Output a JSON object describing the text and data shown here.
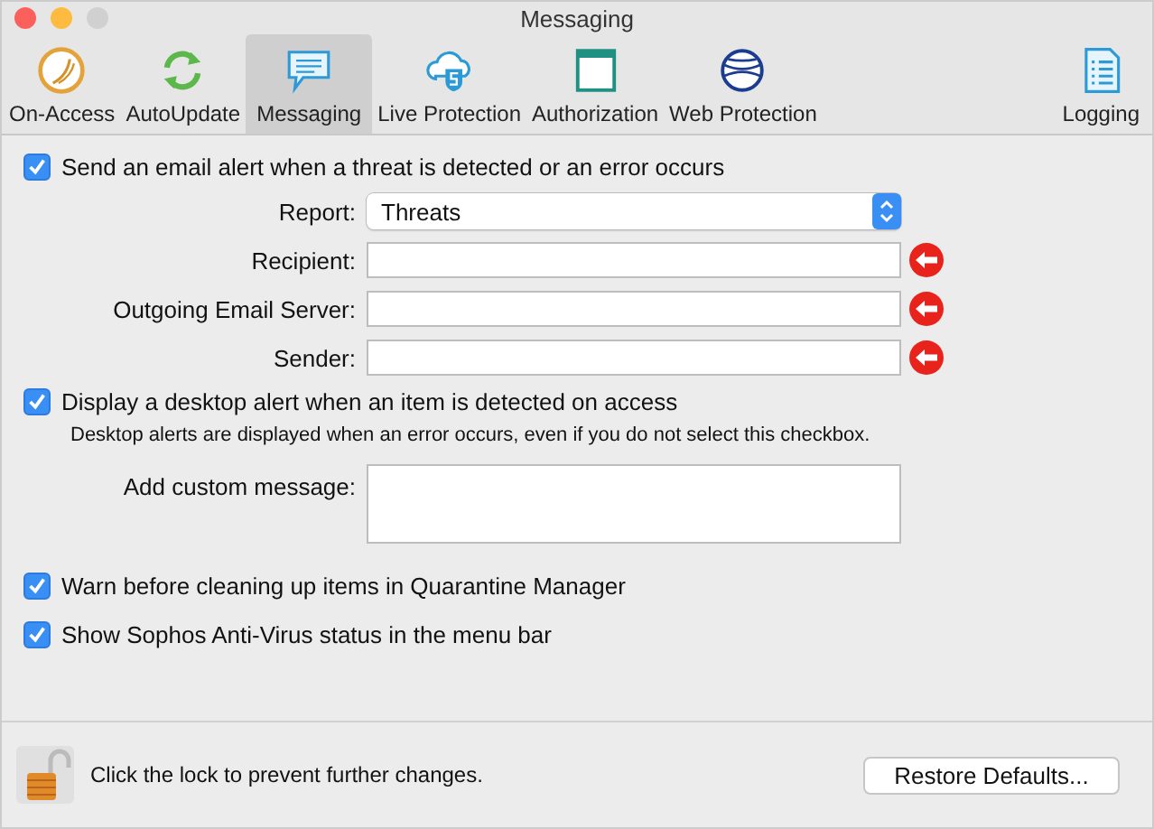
{
  "window": {
    "title": "Messaging"
  },
  "tabs": [
    {
      "label": "On-Access",
      "selected": false
    },
    {
      "label": "AutoUpdate",
      "selected": false
    },
    {
      "label": "Messaging",
      "selected": true
    },
    {
      "label": "Live Protection",
      "selected": false
    },
    {
      "label": "Authorization",
      "selected": false
    },
    {
      "label": "Web Protection",
      "selected": false
    },
    {
      "label": "Logging",
      "selected": false
    }
  ],
  "email_alert": {
    "label": "Send an email alert when a threat is detected or an error occurs",
    "checked": true
  },
  "email_fields": [
    {
      "label": "Report:",
      "kind": "select",
      "value": "Threats"
    },
    {
      "label": "Recipient:",
      "kind": "text"
    },
    {
      "label": "Outgoing Email Server:",
      "kind": "text"
    },
    {
      "label": "Sender:",
      "kind": "text"
    }
  ],
  "desktop_alert": {
    "label": "Display a desktop alert when an item is detected on access",
    "checked": true,
    "note": "Desktop alerts are displayed when an error occurs, even if you do not select this checkbox."
  },
  "custom_message": {
    "label": "Add custom message:"
  },
  "options": [
    {
      "label": "Warn before cleaning up items in Quarantine Manager",
      "checked": true
    },
    {
      "label": "Show Sophos Anti-Virus status in the menu bar",
      "checked": true
    }
  ],
  "footer": {
    "lock_text": "Click the lock to prevent further changes.",
    "button": "Restore Defaults..."
  }
}
